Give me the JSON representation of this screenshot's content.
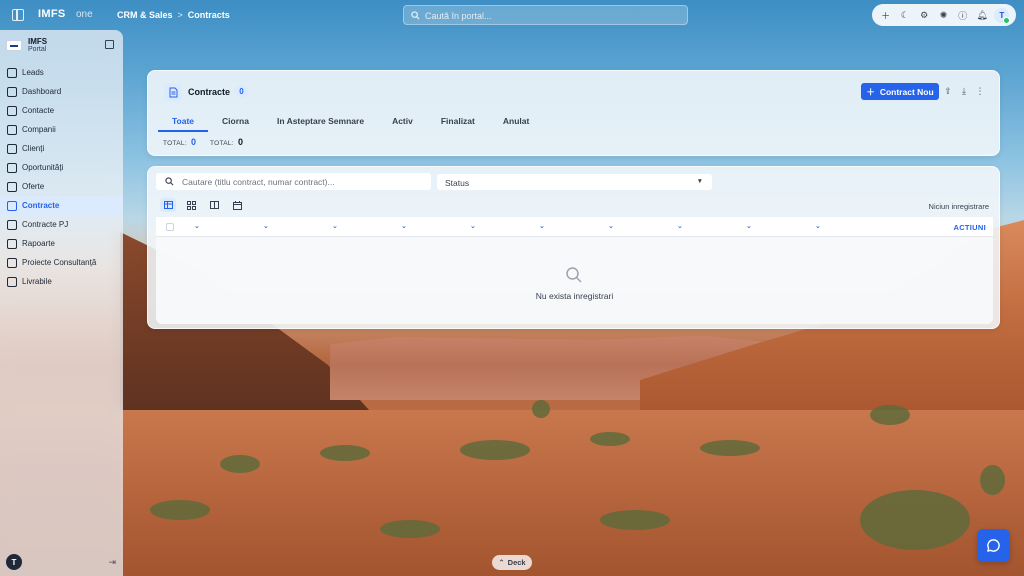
{
  "app": {
    "brand": "IMFS",
    "brand_sub": "one"
  },
  "breadcrumb": {
    "section": "CRM & Sales",
    "separator": ">",
    "page": "Contracts"
  },
  "top_search": {
    "placeholder": "Caută în portal..."
  },
  "toolbar": {
    "icons": [
      "plus-icon",
      "moon-icon",
      "gear-icon",
      "palette-icon",
      "help-icon",
      "bell-icon"
    ],
    "avatar_letter": "T"
  },
  "sidebar": {
    "title": "IMFS",
    "subtitle": "Portal",
    "items": [
      {
        "label": "Leads",
        "icon": "leads-icon"
      },
      {
        "label": "Dashboard",
        "icon": "dashboard-icon"
      },
      {
        "label": "Contacte",
        "icon": "contacts-icon"
      },
      {
        "label": "Companii",
        "icon": "building-icon"
      },
      {
        "label": "Clienți",
        "icon": "users-icon"
      },
      {
        "label": "Oportunități",
        "icon": "target-icon"
      },
      {
        "label": "Oferte",
        "icon": "offer-icon"
      },
      {
        "label": "Contracte",
        "icon": "contract-icon",
        "active": true
      },
      {
        "label": "Contracte PJ",
        "icon": "contract-pj-icon"
      },
      {
        "label": "Rapoarte",
        "icon": "chart-icon"
      },
      {
        "label": "Proiecte Consultanță",
        "icon": "project-icon"
      },
      {
        "label": "Livrabile",
        "icon": "deliverable-icon"
      }
    ],
    "footer_avatar": "T"
  },
  "header": {
    "title": "Contracte",
    "count": "0",
    "new_button": "Contract Nou",
    "tabs": [
      "Toate",
      "Ciorna",
      "In Asteptare Semnare",
      "Activ",
      "Finalizat",
      "Anulat"
    ],
    "active_tab": "Toate",
    "totals": [
      {
        "label": "TOTAL:",
        "value": "0",
        "color": "#2563eb"
      },
      {
        "label": "TOTAL:",
        "value": "0",
        "color": "#111827"
      }
    ]
  },
  "table": {
    "search_placeholder": "Cautare (titlu contract, numar contract)...",
    "status_value": "Status",
    "records_label": "Niciun inregistrare",
    "actions_header": "ACTIUNI",
    "empty_message": "Nu exista inregistrari",
    "view_modes": [
      "table-view-icon",
      "grid-view-icon",
      "columns-view-icon",
      "calendar-view-icon"
    ]
  },
  "bottom": {
    "deck_label": "Deck"
  },
  "colors": {
    "accent": "#2563eb",
    "active_bg": "#dbeafe"
  }
}
